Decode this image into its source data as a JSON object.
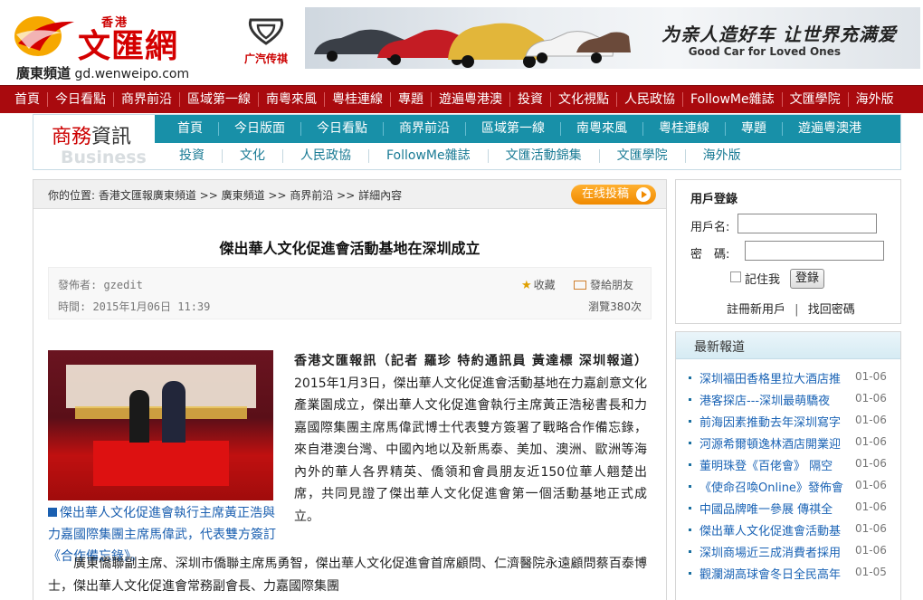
{
  "header": {
    "logo_hk": "香港",
    "logo_brand": "文匯網",
    "logo_channel": "廣東頻道",
    "logo_domain": "gd.wenweipo.com",
    "ad_brand": "广汽传祺",
    "ad_slogan": "为亲人造好车 让世界充满爱",
    "ad_slogan_en": "Good Car for Loved Ones"
  },
  "main_nav": [
    "首頁",
    "今日看點",
    "商界前沿",
    "區域第一線",
    "南粵來風",
    "粵桂連線",
    "專題",
    "遊遍粵港澳",
    "投資",
    "文化視點",
    "人民政協",
    "FollowMe雜誌",
    "文匯學院",
    "海外版"
  ],
  "business": {
    "label_cn_accent": "商務",
    "label_cn": "資訊",
    "label_en": "Business",
    "row1": [
      "首頁",
      "今日版面",
      "今日看點",
      "商界前沿",
      "區域第一線",
      "南粵來風",
      "粵桂連線",
      "專題",
      "遊遍粵澳港"
    ],
    "row2": [
      "投資",
      "文化",
      "人民政協",
      "FollowMe雜誌",
      "文匯活動錦集",
      "文匯學院",
      "海外版"
    ]
  },
  "breadcrumb": "你的位置: 香港文匯報廣東頻道 >> 廣東頻道 >> 商界前沿 >> 詳細內容",
  "submit_label": "在线投稿",
  "article": {
    "title": "傑出華人文化促進會活動基地在深圳成立",
    "author": "發佈者: gzedit",
    "time": "時間: 2015年1月06日 11:39",
    "fav_label": "收藏",
    "share_label": "發給朋友",
    "views": "瀏覽380次",
    "caption": "傑出華人文化促進會執行主席黃正浩與力嘉國際集團主席馬偉武，代表雙方簽訂《合作備忘錄》。",
    "lead_bold": "香港文匯報訊（記者 羅珍 特約通訊員 黃達標 深圳報道）",
    "para1": "2015年1月3日，傑出華人文化促進會活動基地在力嘉創意文化產業園成立，傑出華人文化促進會執行主席黃正浩秘書長和力嘉國際集團主席馬偉武博士代表雙方簽署了戰略合作備忘錄，來自港澳台灣、中國內地以及新馬泰、美加、澳洲、歐洲等海內外的華人各界精英、僑領和會員朋友近150位華人翹楚出席，共同見證了傑出華人文化促進會第一個活動基地正式成立。",
    "para2": "廣東僑聯副主席、深圳市僑聯主席馬勇智，傑出華人文化促進會首席顧問、仁濟醫院永遠顧問蔡百泰博士，傑出華人文化促進會常務副會長、力嘉國際集團"
  },
  "login": {
    "title": "用戶登錄",
    "username_label": "用戶名:",
    "password_label": "密　碼:",
    "remember_label": "記住我",
    "login_button": "登錄",
    "register": "註冊新用戶",
    "forgot": "找回密碼"
  },
  "latest": {
    "title": "最新報道",
    "items": [
      {
        "title": "深圳福田香格里拉大酒店推",
        "date": "01-06"
      },
      {
        "title": "港客探店---深圳最萌驕夜",
        "date": "01-06"
      },
      {
        "title": "前海因素推動去年深圳寫字",
        "date": "01-06"
      },
      {
        "title": "河源希爾頓逸林酒店開業迎",
        "date": "01-06"
      },
      {
        "title": "董明珠登《百佬會》 隔空",
        "date": "01-06"
      },
      {
        "title": "《使命召喚Online》發佈會",
        "date": "01-06"
      },
      {
        "title": "中國品牌唯一參展 傳祺全",
        "date": "01-06"
      },
      {
        "title": "傑出華人文化促進會活動基",
        "date": "01-06"
      },
      {
        "title": "深圳商場近三成消費者採用",
        "date": "01-06"
      },
      {
        "title": "觀瀾湖高球會冬日全民高年",
        "date": "01-05"
      }
    ]
  }
}
